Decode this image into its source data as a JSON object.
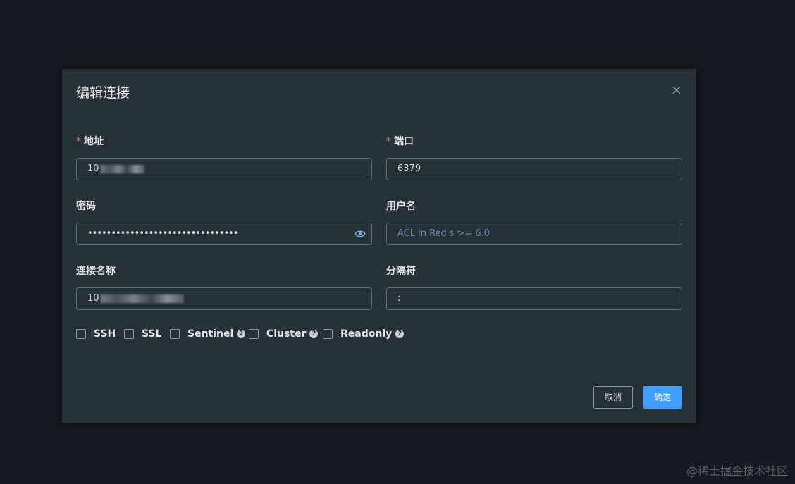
{
  "dialog": {
    "title": "编辑连接",
    "fields": {
      "address": {
        "label": "地址",
        "value": "10",
        "required": true
      },
      "port": {
        "label": "端口",
        "value": "6379",
        "required": true
      },
      "password": {
        "label": "密码",
        "value": "••••••••••••••••••••••••••••••••"
      },
      "username": {
        "label": "用户名",
        "placeholder": "ACL in Redis >= 6.0"
      },
      "conn_name": {
        "label": "连接名称",
        "value": "10"
      },
      "separator": {
        "label": "分隔符",
        "value": ":"
      }
    },
    "required_mark": "*",
    "checkboxes": [
      {
        "label": "SSH",
        "checked": false,
        "help": false
      },
      {
        "label": "SSL",
        "checked": false,
        "help": false
      },
      {
        "label": "Sentinel",
        "checked": false,
        "help": true
      },
      {
        "label": "Cluster",
        "checked": false,
        "help": true
      },
      {
        "label": "Readonly",
        "checked": false,
        "help": true
      }
    ],
    "help_glyph": "?",
    "buttons": {
      "cancel": "取消",
      "ok": "确定"
    }
  },
  "watermark": "@稀土掘金技术社区",
  "colors": {
    "accent": "#409eff",
    "required": "#f56c6c",
    "dialog_bg": "#263238",
    "page_bg": "#141a1f"
  }
}
